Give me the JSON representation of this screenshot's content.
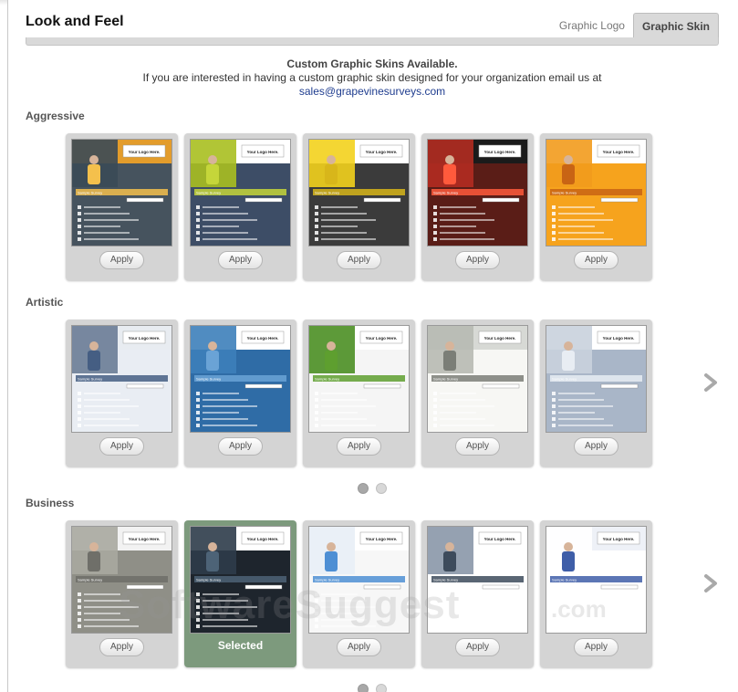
{
  "page_title": "Look and Feel",
  "tabs": [
    {
      "label": "Graphic Logo",
      "active": false
    },
    {
      "label": "Graphic Skin",
      "active": true
    }
  ],
  "notice": {
    "heading": "Custom Graphic Skins Available.",
    "body": "If you are interested in having a custom graphic skin designed for your organization email us at",
    "email": "sales@grapevinesurveys.com"
  },
  "apply_label": "Apply",
  "selected_label": "Selected",
  "sections": [
    {
      "name": "Aggressive",
      "has_next": false,
      "pages": null,
      "current_page": null
    },
    {
      "name": "Artistic",
      "has_next": true,
      "pages": 2,
      "current_page": 1
    },
    {
      "name": "Business",
      "has_next": true,
      "pages": 2,
      "current_page": 1
    }
  ],
  "thumb_text": {
    "logo": "Your Logo Here.",
    "survey": "Sample Survey",
    "progress": "Progress: 0%"
  },
  "watermark": {
    "main": "SoftwareSuggest",
    "sub": ".com"
  },
  "colors": {
    "selected_card": "#7d9a7d",
    "email_link": "#1f3d8f",
    "card_bg": "#d4d4d4"
  }
}
